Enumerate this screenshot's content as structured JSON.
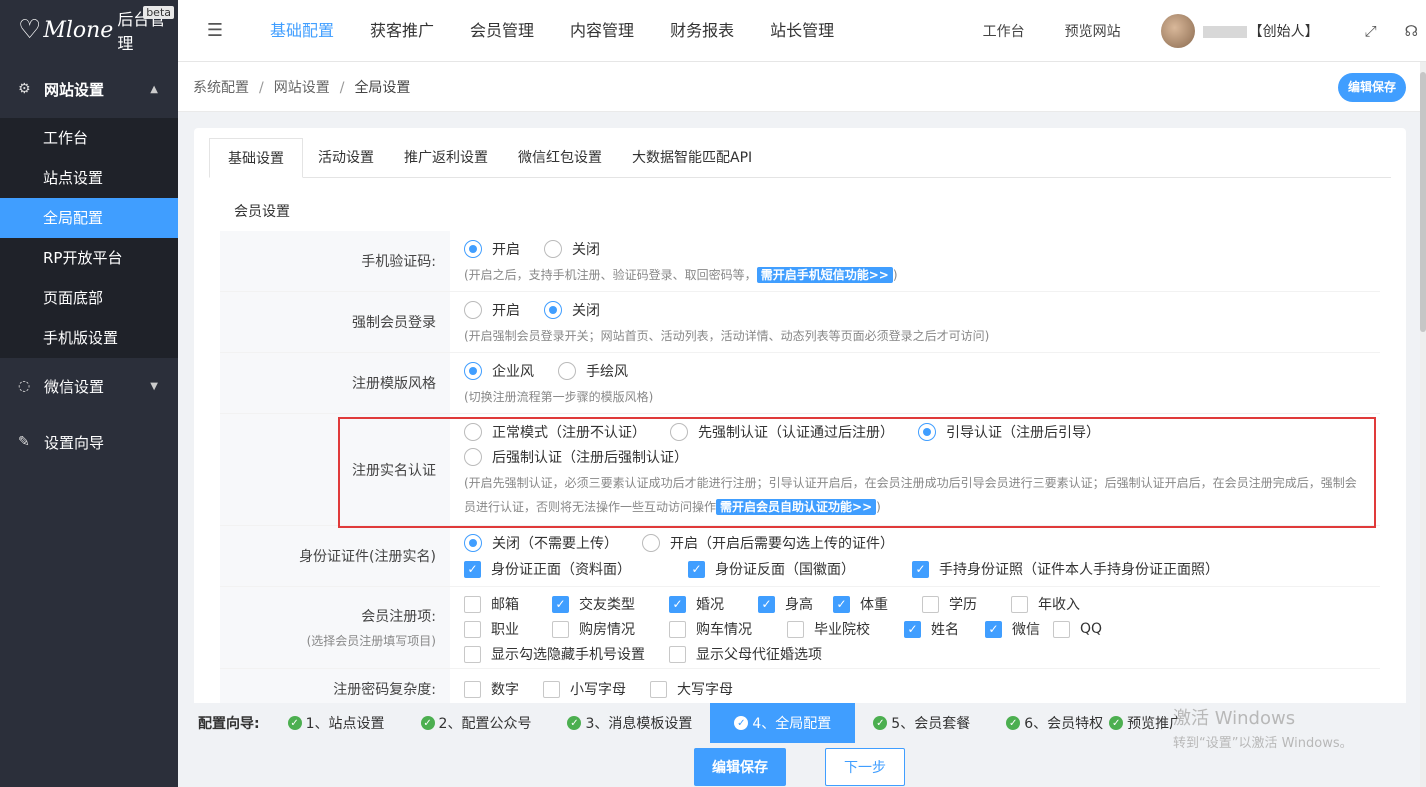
{
  "sidebar": {
    "logo_script": "Mlone",
    "logo_title": "后台管理",
    "beta": "beta",
    "group1": {
      "label": "网站设置",
      "items": [
        {
          "label": "工作台"
        },
        {
          "label": "站点设置"
        },
        {
          "label": "全局配置"
        },
        {
          "label": "RP开放平台"
        },
        {
          "label": "页面底部"
        },
        {
          "label": "手机版设置"
        }
      ]
    },
    "group2": {
      "label": "微信设置"
    },
    "group3": {
      "label": "设置向导"
    }
  },
  "topnav": {
    "items": [
      {
        "label": "基础配置"
      },
      {
        "label": "获客推广"
      },
      {
        "label": "会员管理"
      },
      {
        "label": "内容管理"
      },
      {
        "label": "财务报表"
      },
      {
        "label": "站长管理"
      }
    ],
    "workbench": "工作台",
    "preview": "预览网站",
    "user_role": "【创始人】"
  },
  "breadcrumb": {
    "l1": "系统配置",
    "l2": "网站设置",
    "l3": "全局设置",
    "sep": "/"
  },
  "edit_save_pill": "编辑保存",
  "tabs": [
    {
      "label": "基础设置"
    },
    {
      "label": "活动设置"
    },
    {
      "label": "推广返利设置"
    },
    {
      "label": "微信红包设置"
    },
    {
      "label": "大数据智能匹配API"
    }
  ],
  "section_title": "会员设置",
  "rows": {
    "sms": {
      "label": "手机验证码:",
      "opt1": "开启",
      "opt2": "关闭",
      "hint": "(开启之后，支持手机注册、验证码登录、取回密码等，",
      "link": "需开启手机短信功能>>",
      "hint_end": ")"
    },
    "force": {
      "label": "强制会员登录",
      "opt1": "开启",
      "opt2": "关闭",
      "hint": "(开启强制会员登录开关；网站首页、活动列表，活动详情、动态列表等页面必须登录之后才可访问)"
    },
    "template": {
      "label": "注册模版风格",
      "opt1": "企业风",
      "opt2": "手绘风",
      "hint": "(切换注册流程第一步骤的模版风格)"
    },
    "realname": {
      "label": "注册实名认证",
      "opt1": "正常模式（注册不认证）",
      "opt2": "先强制认证（认证通过后注册）",
      "opt3": "引导认证（注册后引导）",
      "opt4": "后强制认证（注册后强制认证）",
      "hint1": "(开启先强制认证，必须三要素认证成功后才能进行注册；引导认证开启后，在会员注册成功后引导会员进行三要素认证；后强制认证开启后，在会员注册完成后，强制会",
      "hint2": "员进行认证，否则将无法操作一些互动访问操作",
      "link": "需开启会员自助认证功能>>",
      "hint_end": ")"
    },
    "idcard": {
      "label": "身份证证件(注册实名)",
      "opt1": "关闭（不需要上传）",
      "opt2": "开启（开启后需要勾选上传的证件）",
      "cb1": "身份证正面（资料面）",
      "cb2": "身份证反面（国徽面）",
      "cb3": "手持身份证照（证件本人手持身份证正面照）"
    },
    "regitems": {
      "label": "会员注册项:",
      "sub": "(选择会员注册填写项目)",
      "items": [
        {
          "label": "邮箱"
        },
        {
          "label": "交友类型"
        },
        {
          "label": "婚况"
        },
        {
          "label": "身高"
        },
        {
          "label": "体重"
        },
        {
          "label": "学历"
        },
        {
          "label": "年收入"
        },
        {
          "label": "职业"
        },
        {
          "label": "购房情况"
        },
        {
          "label": "购车情况"
        },
        {
          "label": "毕业院校"
        },
        {
          "label": "姓名"
        },
        {
          "label": "微信"
        },
        {
          "label": "QQ"
        }
      ],
      "extra1": "显示勾选隐藏手机号设置",
      "extra2": "显示父母代征婚选项"
    },
    "pwd": {
      "label": "注册密码复杂度:",
      "cb1": "数字",
      "cb2": "小写字母",
      "cb3": "大写字母"
    }
  },
  "guide": {
    "label": "配置向导:",
    "steps": [
      {
        "label": "1、站点设置"
      },
      {
        "label": "2、配置公众号"
      },
      {
        "label": "3、消息模板设置"
      },
      {
        "label": "4、全局配置"
      },
      {
        "label": "5、会员套餐"
      },
      {
        "label": "6、会员特权"
      },
      {
        "label": "预览推广"
      }
    ]
  },
  "buttons": {
    "save": "编辑保存",
    "next": "下一步"
  },
  "watermark": {
    "line1": "激活 Windows",
    "line2": "转到“设置”以激活 Windows。"
  },
  "colors": {
    "accent": "#409eff",
    "sidebar_bg": "#2b2f3a",
    "highlight_box": "#e03a3a",
    "ok_green": "#4caf50"
  }
}
